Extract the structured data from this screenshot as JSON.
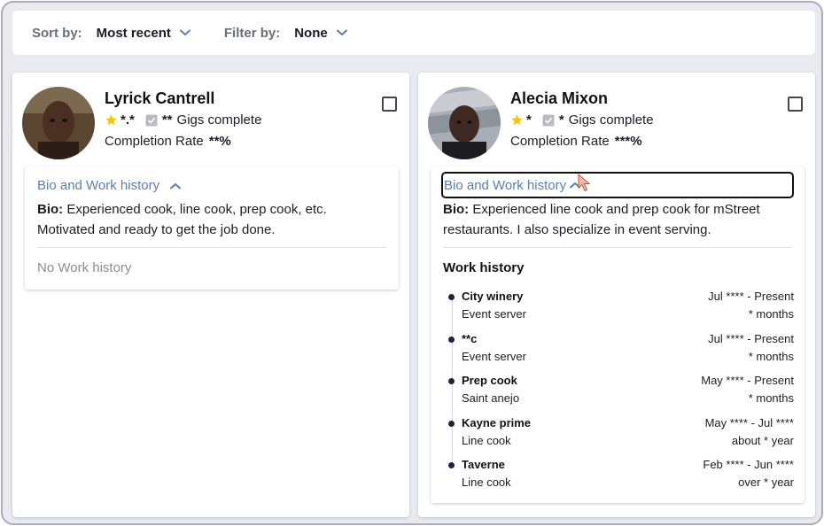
{
  "filters": {
    "sort_label": "Sort by:",
    "sort_value": "Most recent",
    "filter_label": "Filter by:",
    "filter_value": "None"
  },
  "workers": [
    {
      "name": "Lyrick Cantrell",
      "rating": "*.*",
      "gigs_count": "**",
      "gigs_label": "Gigs complete",
      "completion_label": "Completion Rate",
      "completion_value": "**%",
      "accordion_label": "Bio and Work history",
      "bio_label": "Bio:",
      "bio_text": "Experienced cook, line cook, prep cook, etc. Motivated and ready to get the job done.",
      "no_work_history": "No Work history"
    },
    {
      "name": "Alecia Mixon",
      "rating": "*",
      "gigs_count": "*",
      "gigs_label": "Gigs complete",
      "completion_label": "Completion Rate",
      "completion_value": "***%",
      "accordion_label": "Bio and Work history",
      "bio_label": "Bio:",
      "bio_text": "Experienced line cook and prep cook for mStreet restaurants. I also specialize in event serving.",
      "work_history_title": "Work history",
      "jobs": [
        {
          "title": "City winery",
          "role": "Event server",
          "dates": "Jul **** - Present",
          "duration": "* months"
        },
        {
          "title": "**c",
          "role": "Event server",
          "dates": "Jul **** - Present",
          "duration": "* months"
        },
        {
          "title": "Prep cook",
          "role": "Saint anejo",
          "dates": "May **** - Present",
          "duration": "* months"
        },
        {
          "title": "Kayne prime",
          "role": "Line cook",
          "dates": "May **** - Jul ****",
          "duration": "about * year"
        },
        {
          "title": "Taverne",
          "role": "Line cook",
          "dates": "Feb **** - Jun ****",
          "duration": "over * year"
        }
      ]
    }
  ],
  "icons": {
    "star": "star-icon",
    "gigs": "check-badge-icon",
    "chevron": "chevron-down-icon",
    "collapse": "chevron-up-icon"
  },
  "colors": {
    "accent": "#5b7fb0",
    "star": "#f2c511",
    "background": "#e9eaf0"
  }
}
